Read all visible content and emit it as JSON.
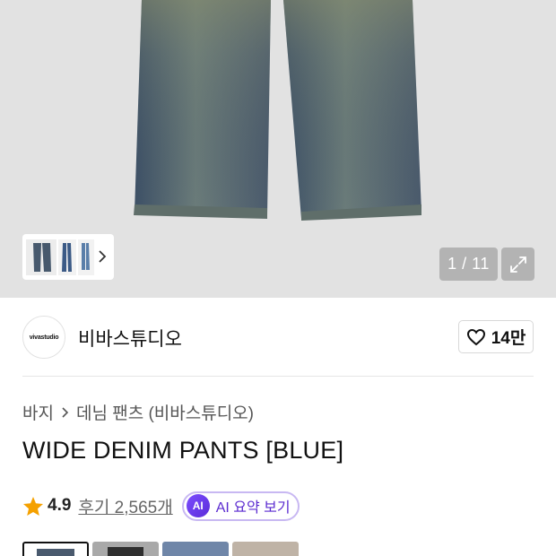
{
  "gallery": {
    "counter": "1 / 11",
    "expand_icon": "expand-icon",
    "thumb_next_icon": "chevron-right-icon"
  },
  "brand": {
    "logo_text": "vivastudio",
    "name": "비바스튜디오",
    "like_icon": "heart-outline-icon",
    "like_count": "14만"
  },
  "breadcrumb": {
    "items": [
      "바지",
      "데님 팬츠 (비바스튜디오)"
    ],
    "separator_icon": "chevron-right-icon"
  },
  "product": {
    "title": "WIDE DENIM PANTS [BLUE]",
    "rating": "4.9",
    "reviews": "후기 2,565개",
    "ai_badge": "AI",
    "ai_summary": "AI 요약 보기"
  },
  "colors": {
    "star": "#f5a100",
    "accent": "#5b2bd0",
    "swatch_colors": [
      "#4a5a6e",
      "#a9a9a9",
      "#6f86a8",
      "#bfb3a6"
    ]
  }
}
